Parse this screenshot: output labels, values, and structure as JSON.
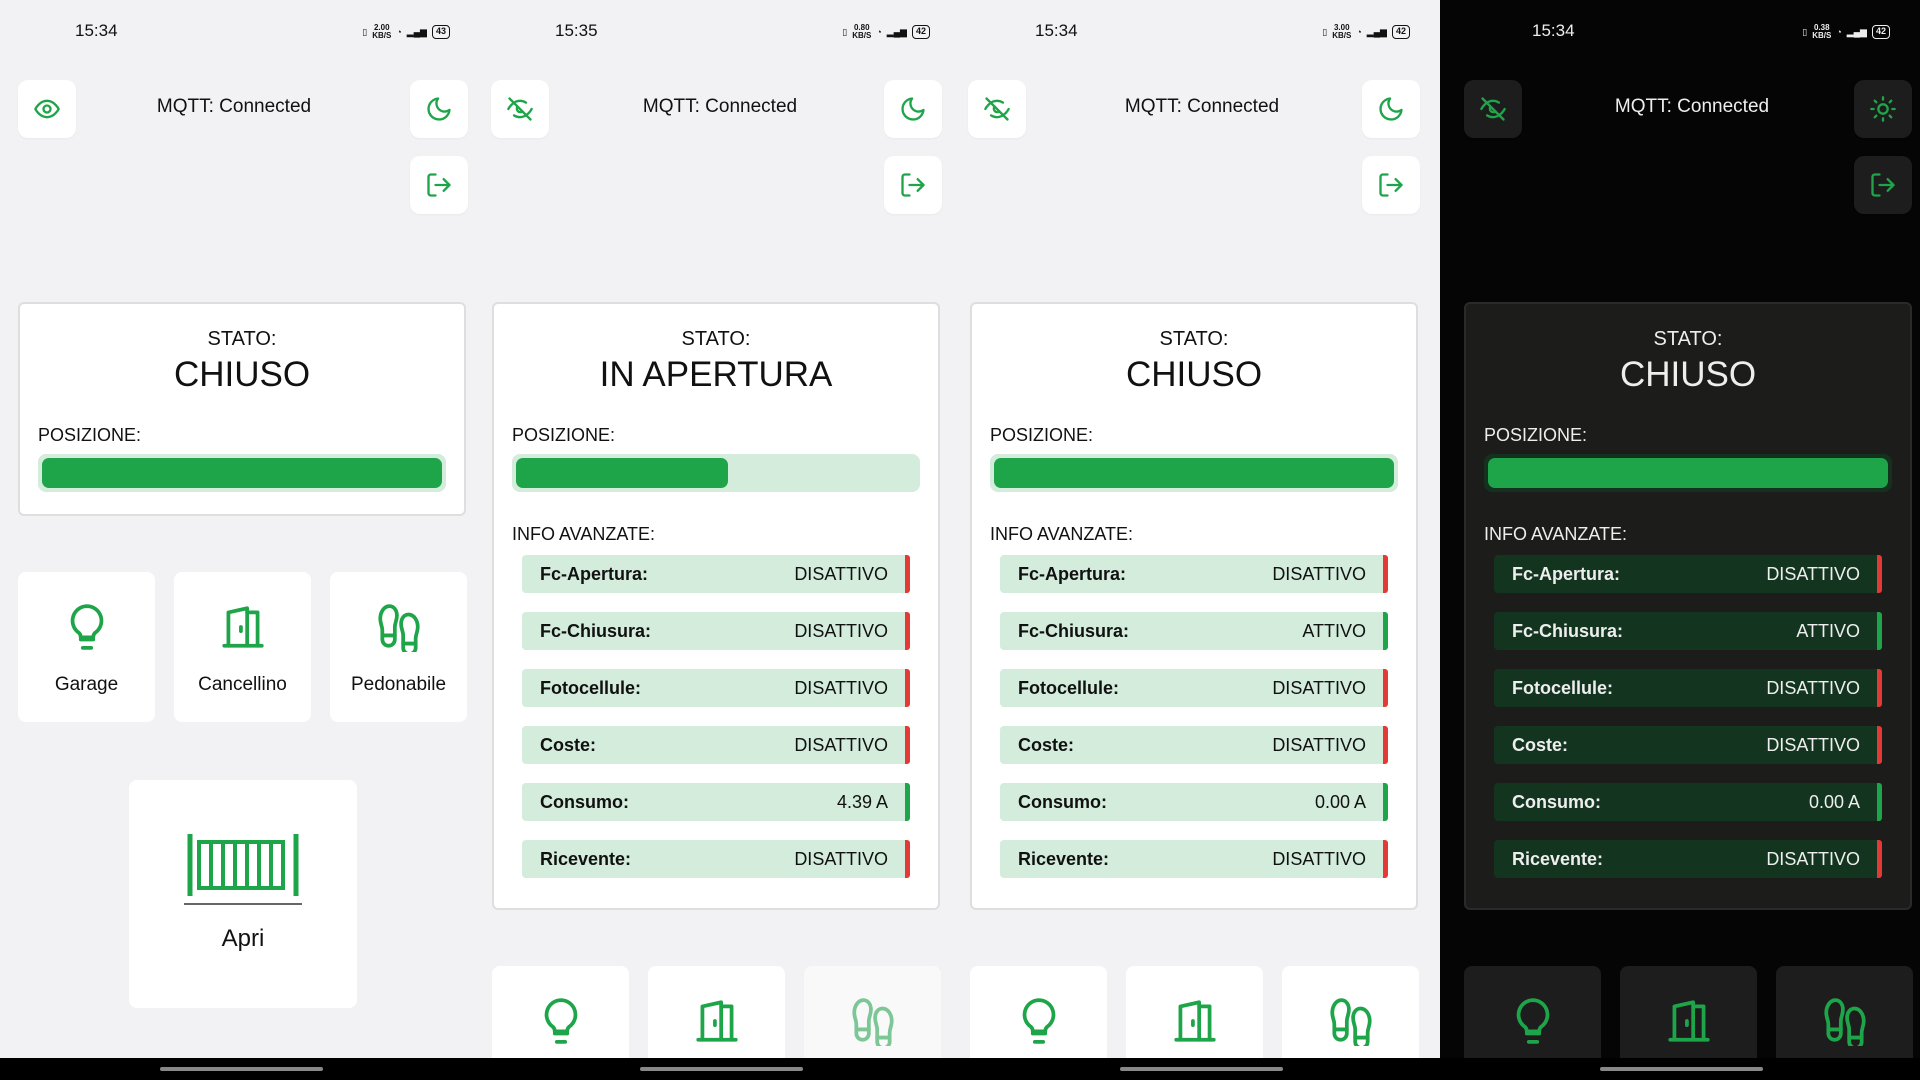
{
  "screens": [
    {
      "status": {
        "time": "15:34",
        "speed_top": "2.00",
        "speed_unit": "KB/S",
        "battery": "43"
      },
      "mqtt_text": "MQTT: Connected",
      "visibility_icon": "eye-icon",
      "theme_icon": "moon-icon",
      "stato_label": "STATO:",
      "stato_value": "CHIUSO",
      "posizione_label": "POSIZIONE:",
      "position_fraction": 1.0,
      "tiles": [
        {
          "label": "Garage",
          "icon": "lightbulb-icon"
        },
        {
          "label": "Cancellino",
          "icon": "door-icon"
        },
        {
          "label": "Pedonabile",
          "icon": "footprints-icon"
        }
      ],
      "apri_label": "Apri"
    },
    {
      "status": {
        "time": "15:35",
        "speed_top": "0.80",
        "speed_unit": "KB/S",
        "battery": "42"
      },
      "mqtt_text": "MQTT: Connected",
      "visibility_icon": "eye-off-icon",
      "theme_icon": "moon-icon",
      "stato_label": "STATO:",
      "stato_value": "IN APERTURA",
      "posizione_label": "POSIZIONE:",
      "position_fraction": 0.53,
      "info_label": "INFO AVANZATE:",
      "info": [
        {
          "key": "Fc-Apertura:",
          "value": "DISATTIVO",
          "state": "red"
        },
        {
          "key": "Fc-Chiusura:",
          "value": "DISATTIVO",
          "state": "red"
        },
        {
          "key": "Fotocellule:",
          "value": "DISATTIVO",
          "state": "red"
        },
        {
          "key": "Coste:",
          "value": "DISATTIVO",
          "state": "red"
        },
        {
          "key": "Consumo:",
          "value": "4.39 A",
          "state": "green"
        },
        {
          "key": "Ricevente:",
          "value": "DISATTIVO",
          "state": "red"
        }
      ]
    },
    {
      "status": {
        "time": "15:34",
        "speed_top": "3.00",
        "speed_unit": "KB/S",
        "battery": "42"
      },
      "mqtt_text": "MQTT: Connected",
      "visibility_icon": "eye-off-icon",
      "theme_icon": "moon-icon",
      "stato_label": "STATO:",
      "stato_value": "CHIUSO",
      "posizione_label": "POSIZIONE:",
      "position_fraction": 1.0,
      "info_label": "INFO AVANZATE:",
      "info": [
        {
          "key": "Fc-Apertura:",
          "value": "DISATTIVO",
          "state": "red"
        },
        {
          "key": "Fc-Chiusura:",
          "value": "ATTIVO",
          "state": "green"
        },
        {
          "key": "Fotocellule:",
          "value": "DISATTIVO",
          "state": "red"
        },
        {
          "key": "Coste:",
          "value": "DISATTIVO",
          "state": "red"
        },
        {
          "key": "Consumo:",
          "value": "0.00 A",
          "state": "green"
        },
        {
          "key": "Ricevente:",
          "value": "DISATTIVO",
          "state": "red"
        }
      ]
    },
    {
      "status": {
        "time": "15:34",
        "speed_top": "0.38",
        "speed_unit": "KB/S",
        "battery": "42"
      },
      "mqtt_text": "MQTT: Connected",
      "visibility_icon": "eye-off-icon",
      "theme_icon": "sun-icon",
      "stato_label": "STATO:",
      "stato_value": "CHIUSO",
      "posizione_label": "POSIZIONE:",
      "position_fraction": 1.0,
      "info_label": "INFO AVANZATE:",
      "info": [
        {
          "key": "Fc-Apertura:",
          "value": "DISATTIVO",
          "state": "red"
        },
        {
          "key": "Fc-Chiusura:",
          "value": "ATTIVO",
          "state": "green"
        },
        {
          "key": "Fotocellule:",
          "value": "DISATTIVO",
          "state": "red"
        },
        {
          "key": "Coste:",
          "value": "DISATTIVO",
          "state": "red"
        },
        {
          "key": "Consumo:",
          "value": "0.00 A",
          "state": "green"
        },
        {
          "key": "Ricevente:",
          "value": "DISATTIVO",
          "state": "red"
        }
      ]
    }
  ],
  "colors": {
    "accent": "#1ea54a",
    "accent_light": "#d3ecdc",
    "inactive": "#e53935",
    "light_bg": "#f2f2f4",
    "dark_bg": "#050505"
  }
}
